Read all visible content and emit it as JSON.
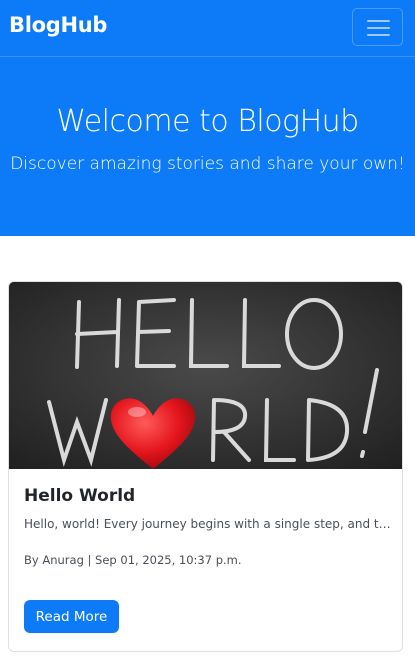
{
  "navbar": {
    "brand": "BlogHub",
    "toggle_icon": "hamburger-menu-icon"
  },
  "hero": {
    "title": "Welcome to BlogHub",
    "subtitle": "Discover amazing stories and share your own!"
  },
  "posts": [
    {
      "image_alt": "HELLO WORLD",
      "image_text_line1": "HELLO",
      "image_text_line2_pre": "W",
      "image_text_line2_post": "RLD!",
      "title": "Hello World",
      "excerpt": "Hello, world! Every journey begins with a single step, and this is mine.",
      "meta": "By Anurag | Sep 01, 2025, 10:37 p.m.",
      "button_label": "Read More"
    }
  ],
  "colors": {
    "primary": "#0d7bf7",
    "heart": "#e3141c",
    "chalkboard": "#2e2e2e"
  }
}
